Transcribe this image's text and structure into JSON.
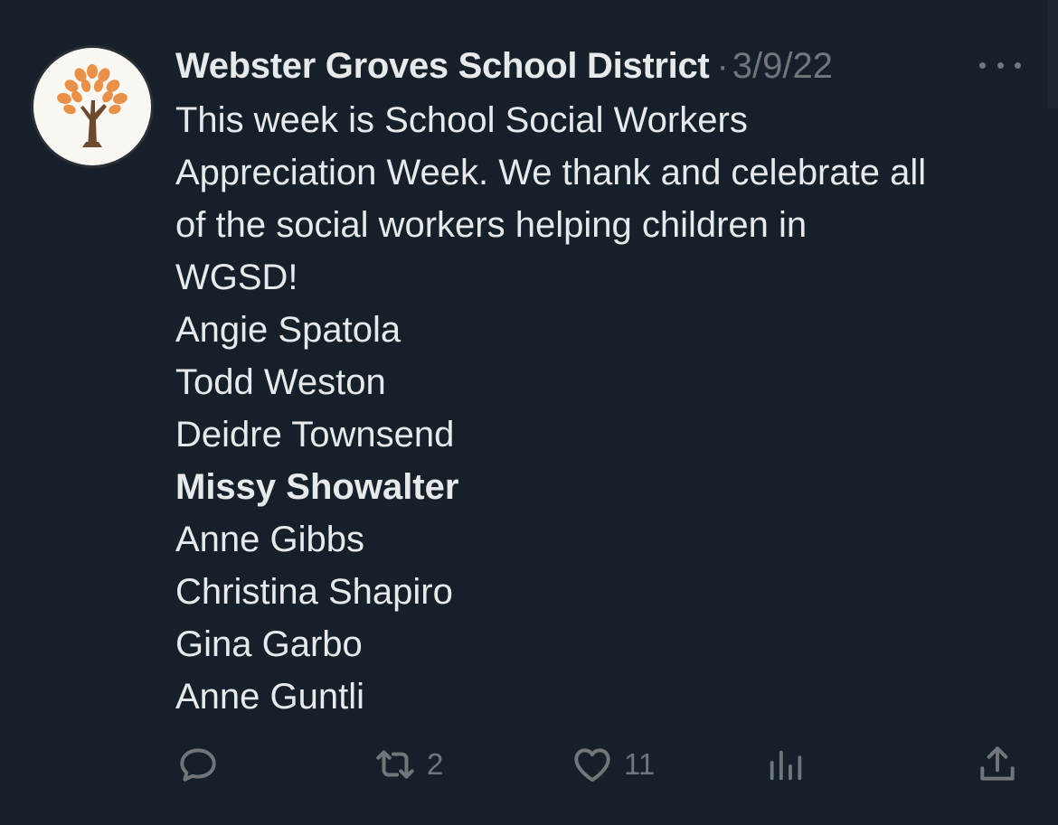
{
  "tweet": {
    "author": {
      "display_name": "Webster Groves School District",
      "avatar_icon": "tree-logo-icon"
    },
    "separator": "·",
    "timestamp": "3/9/22",
    "more_icon": "more-horizontal-icon",
    "text_lines": [
      "This week is School Social Workers",
      "Appreciation Week. We thank and celebrate all",
      "of the social workers helping children in",
      "WGSD!"
    ],
    "names": [
      {
        "name": "Angie Spatola",
        "bold": false
      },
      {
        "name": "Todd Weston",
        "bold": false
      },
      {
        "name": "Deidre Townsend",
        "bold": false
      },
      {
        "name": "Missy Showalter",
        "bold": true
      },
      {
        "name": "Anne Gibbs",
        "bold": false
      },
      {
        "name": "Christina Shapiro",
        "bold": false
      },
      {
        "name": "Gina Garbo",
        "bold": false
      },
      {
        "name": "Anne Guntli",
        "bold": false
      }
    ],
    "actions": {
      "reply": {
        "icon": "reply-icon",
        "count": ""
      },
      "retweet": {
        "icon": "retweet-icon",
        "count": "2"
      },
      "like": {
        "icon": "heart-icon",
        "count": "11"
      },
      "views": {
        "icon": "views-chart-icon",
        "count": ""
      },
      "share": {
        "icon": "share-icon",
        "count": ""
      }
    }
  },
  "colors": {
    "background": "#16202a",
    "text_primary": "#e7e9ea",
    "text_secondary": "#71767b",
    "logo_orange": "#e8914a",
    "logo_trunk": "#6b4a2f"
  }
}
